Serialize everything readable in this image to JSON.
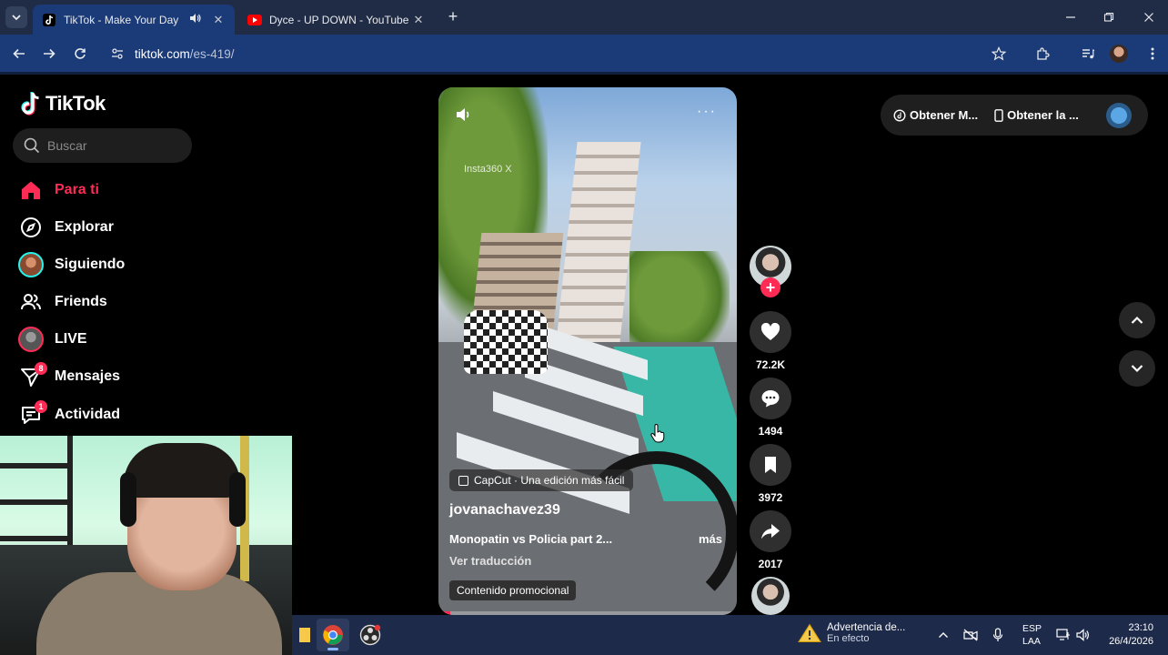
{
  "browser": {
    "tabs": [
      {
        "title": "TikTok - Make Your Day",
        "active": true
      },
      {
        "title": "Dyce - UP DOWN - YouTube",
        "active": false
      }
    ],
    "url_host": "tiktok.com",
    "url_path": "/es-419/"
  },
  "sidebar": {
    "logo": "TikTok",
    "search_placeholder": "Buscar",
    "items": [
      {
        "label": "Para ti",
        "icon": "home-icon",
        "active": true
      },
      {
        "label": "Explorar",
        "icon": "compass-icon"
      },
      {
        "label": "Siguiendo",
        "icon": "avatar-icon"
      },
      {
        "label": "Friends",
        "icon": "friends-icon"
      },
      {
        "label": "LIVE",
        "icon": "live-avatar-icon"
      },
      {
        "label": "Mensajes",
        "icon": "messages-icon",
        "badge": "8"
      },
      {
        "label": "Actividad",
        "icon": "activity-icon",
        "badge": "1"
      }
    ]
  },
  "video": {
    "watermark": "Insta360 X",
    "capcut_chip": "CapCut · Una edición más fácil",
    "author": "jovanachavez39",
    "description": "Monopatin vs Policia part 2...",
    "more": "más",
    "translate": "Ver traducción",
    "promo": "Contenido promocional",
    "progress": 0.04
  },
  "actions": {
    "likes": "72.2K",
    "comments": "1494",
    "saves": "3972",
    "shares": "2017"
  },
  "top_pill": {
    "item1": "Obtener M...",
    "item2": "Obtener la ..."
  },
  "taskbar": {
    "warning_title": "Advertencia de...",
    "warning_sub": "En efecto",
    "lang_1": "ESP",
    "lang_2": "LAA",
    "time": "23:10",
    "date": "26/4/2026"
  },
  "colors": {
    "accent": "#fe2c55",
    "cyan": "#25f4ee",
    "chrome_blue": "#1a3a78"
  }
}
